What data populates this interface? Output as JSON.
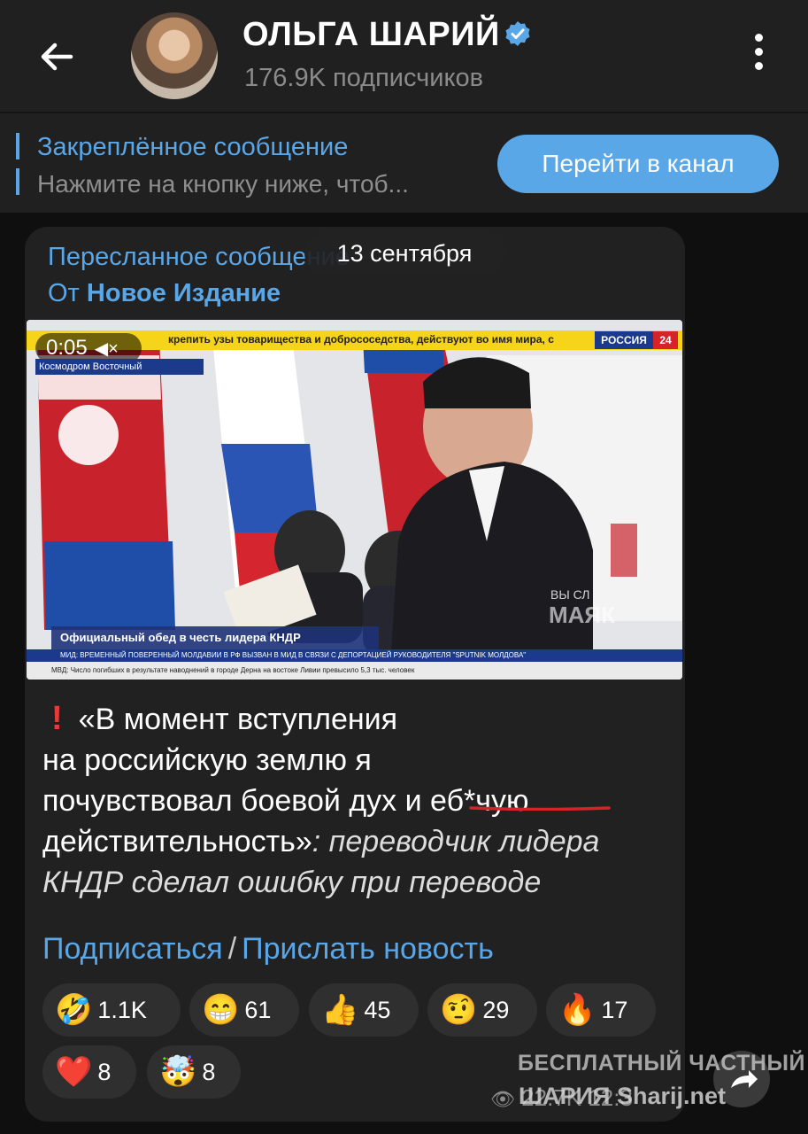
{
  "header": {
    "title": "ОЛЬГА ШАРИЙ",
    "subtitle": "176.9K подписчиков"
  },
  "pinned": {
    "title": "Закреплённое сообщение",
    "text": "Нажмите на кнопку ниже, чтоб...",
    "button": "Перейти в канал"
  },
  "post": {
    "forwarded_label": "Пересланное сообщение",
    "from_prefix": "От",
    "from_name": "Новое Издание",
    "date_pill": "13 сентября",
    "video": {
      "time": "0:05",
      "location": "Космодром Восточный",
      "ticker_top": "крепить узы товарищества и добрососедства, действуют во имя мира, с",
      "channel": "РОССИЯ",
      "channel_num": "24",
      "caption": "Официальный обед в честь лидера КНДР",
      "ticker_1": "МИД: ВРЕМЕННЫЙ ПОВЕРЕННЫЙ МОЛДАВИИ В РФ ВЫЗВАН В МИД В СВЯЗИ С ДЕПОРТАЦИЕЙ РУКОВОДИТЕЛЯ \"SPUTNIK МОЛДОВА\"",
      "ticker_2": "МВД: Число погибших в результате наводнений в городе Дерна на востоке Ливии превысило 5,3 тыс. человек"
    },
    "text": {
      "quote_1": "«В момент вступления",
      "quote_2": "на российскую землю я",
      "quote_3": "почувствовал боевой дух и еб*чую",
      "quote_4": "действительность»",
      "rest_4": ": переводчик лидера",
      "rest_5": "КНДР сделал ошибку при переводе"
    },
    "links": {
      "subscribe": "Подписаться",
      "separator": "/",
      "send_news": "Прислать новость"
    },
    "reactions": [
      {
        "emoji": "🤣",
        "count": "1.1K"
      },
      {
        "emoji": "😁",
        "count": "61"
      },
      {
        "emoji": "👍",
        "count": "45"
      },
      {
        "emoji": "🤨",
        "count": "29"
      },
      {
        "emoji": "🔥",
        "count": "17"
      },
      {
        "emoji": "❤️",
        "count": "8"
      },
      {
        "emoji": "🤯",
        "count": "8"
      }
    ],
    "meta_time": "22.7K 12:3"
  },
  "watermark": {
    "line1": "БЕСПЛАТНЫЙ ЧАСТНЫЙ",
    "line2": "ШАРИЯ  Sharij.net"
  }
}
